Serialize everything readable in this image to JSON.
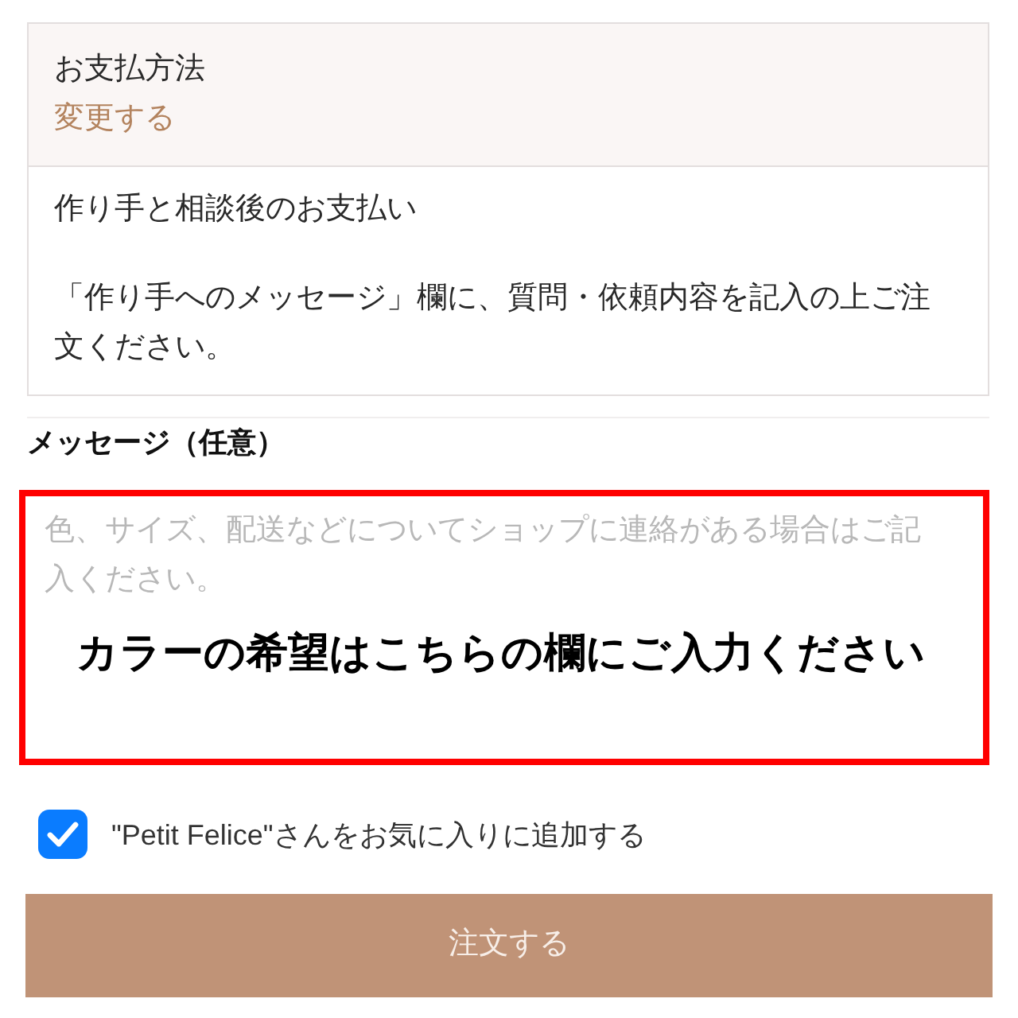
{
  "payment": {
    "title": "お支払方法",
    "change_link": "変更する",
    "method": "作り手と相談後のお支払い",
    "note": "「作り手へのメッセージ」欄に、質問・依頼内容を記入の上ご注文ください。"
  },
  "message": {
    "label": "メッセージ（任意）",
    "placeholder": "色、サイズ、配送などについてショップに連絡がある場合はご記入ください。",
    "annotation": "カラーの希望はこちらの欄にご入力ください"
  },
  "favorite": {
    "label": "\"Petit Felice\"さんをお気に入りに追加する",
    "checked": true
  },
  "order_button": {
    "label": "注文する"
  }
}
